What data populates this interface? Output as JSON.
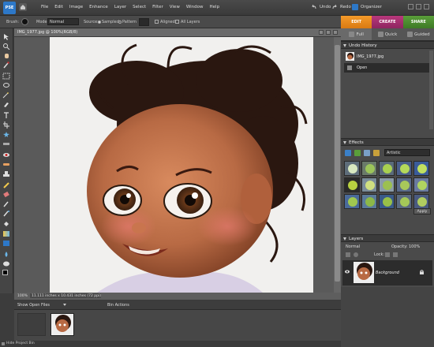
{
  "app": {
    "logo_text": "PSE",
    "menu": [
      "File",
      "Edit",
      "Image",
      "Enhance",
      "Layer",
      "Select",
      "Filter",
      "View",
      "Window",
      "Help"
    ],
    "undo_label": "Undo",
    "redo_label": "Redo",
    "organizer_label": "Organizer"
  },
  "options": {
    "brush_label": "Brush:",
    "mode_label": "Mode:",
    "mode_value": "Normal",
    "source_label": "Source:",
    "sampled_label": "Sampled",
    "pattern_label": "Pattern",
    "aligned_label": "Aligned",
    "all_layers_label": "All Layers"
  },
  "modes": {
    "edit": "EDIT",
    "create": "CREATE",
    "share": "SHARE",
    "full": "Full",
    "quick": "Quick",
    "guided": "Guided"
  },
  "document": {
    "title": "IMG_1977.jpg @ 100%(RGB/8)",
    "zoom": "100%",
    "info": "11.111 inches x 10.431 inches (72 ppi)"
  },
  "bin": {
    "show_label": "Show Open Files",
    "actions_label": "Bin Actions",
    "hide_label": "Hide Project Bin"
  },
  "undo_history": {
    "title": "Undo History",
    "items": [
      {
        "label": "IMG_1977.jpg",
        "selected": false
      },
      {
        "label": "Open",
        "selected": true
      }
    ]
  },
  "effects": {
    "title": "Effects",
    "category": "Artistic",
    "apply_label": "Apply"
  },
  "layers": {
    "title": "Layers",
    "blend_mode": "Normal",
    "opacity_label": "Opacity:",
    "opacity_value": "100%",
    "lock_label": "Lock:",
    "layer_name": "Background"
  },
  "colors": {
    "edit_tab": "#e8891c",
    "create_tab": "#a3306e",
    "share_tab": "#4e8e32"
  }
}
